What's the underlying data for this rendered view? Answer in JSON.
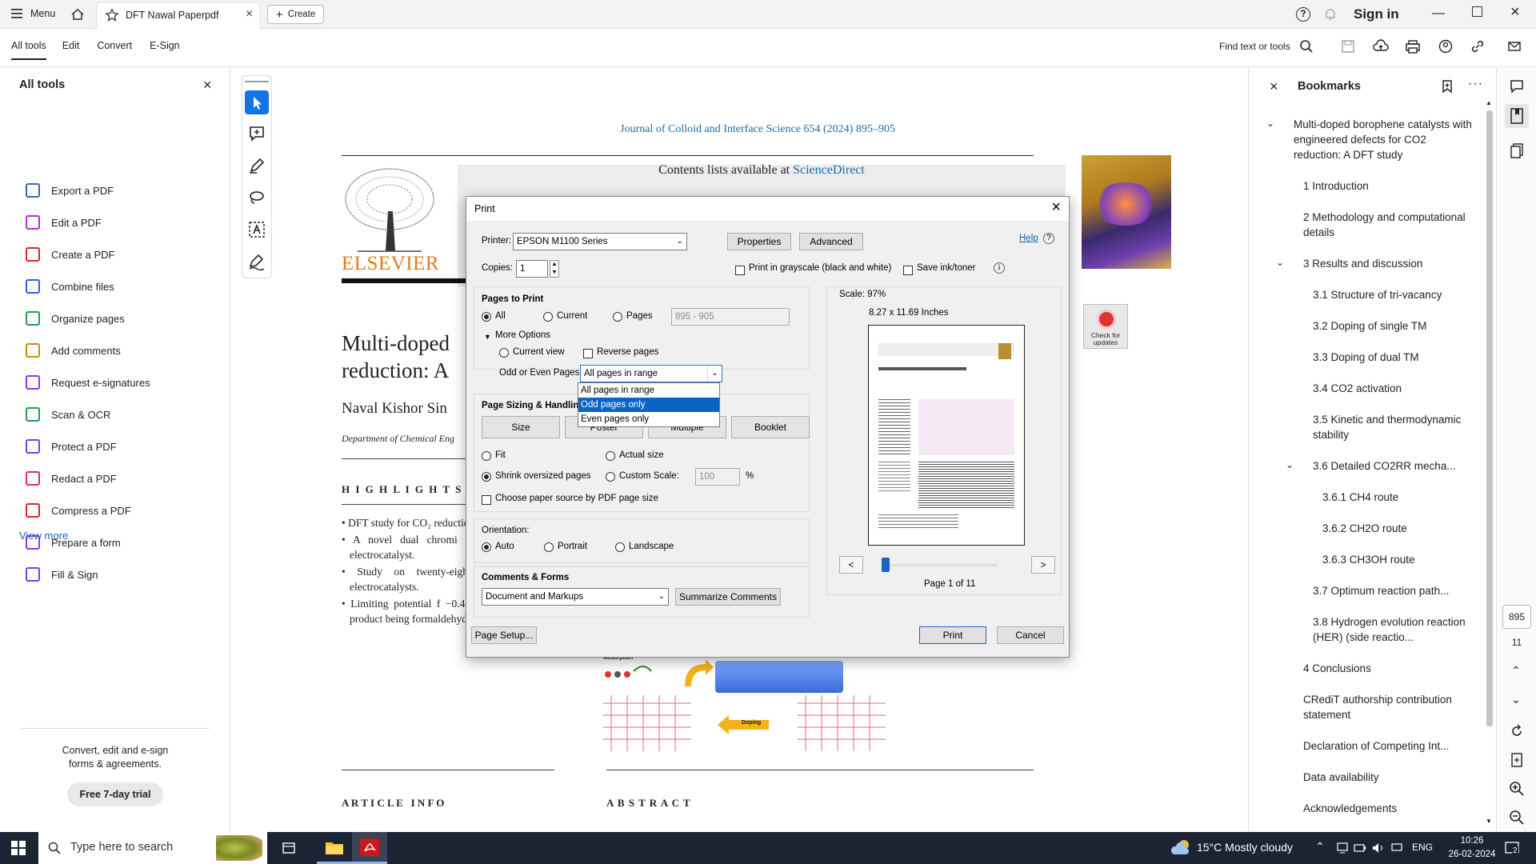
{
  "titlebar": {
    "menu_label": "Menu",
    "tab_title": "DFT Nawal Paperpdf",
    "create_label": "Create",
    "sign_in": "Sign in"
  },
  "toolbar": {
    "menus": [
      "All tools",
      "Edit",
      "Convert",
      "E-Sign"
    ],
    "find_label": "Find text or tools"
  },
  "left_panel": {
    "title": "All tools",
    "items": [
      {
        "label": "Export a PDF",
        "color": "#2b6cb0"
      },
      {
        "label": "Edit a PDF",
        "color": "#c026d3"
      },
      {
        "label": "Create a PDF",
        "color": "#dc2626"
      },
      {
        "label": "Combine files",
        "color": "#2563eb"
      },
      {
        "label": "Organize pages",
        "color": "#16a34a"
      },
      {
        "label": "Add comments",
        "color": "#ca8a04"
      },
      {
        "label": "Request e-signatures",
        "color": "#9333ea"
      },
      {
        "label": "Scan & OCR",
        "color": "#16a34a"
      },
      {
        "label": "Protect a PDF",
        "color": "#7c3aed"
      },
      {
        "label": "Redact a PDF",
        "color": "#db2777"
      },
      {
        "label": "Compress a PDF",
        "color": "#dc2626"
      },
      {
        "label": "Prepare a form",
        "color": "#9333ea"
      },
      {
        "label": "Fill & Sign",
        "color": "#7c3aed"
      }
    ],
    "view_more": "View more",
    "promo_line1": "Convert, edit and e-sign",
    "promo_line2": "forms & agreements.",
    "trial_button": "Free 7-day trial"
  },
  "document": {
    "journal": "Journal of Colloid and Interface Science 654 (2024) 895–905",
    "contents_prefix": "Contents lists available at",
    "contents_link": "ScienceDirect",
    "publisher": "ELSEVIER",
    "title_line1": "Multi-doped",
    "title_line2": "reduction: A",
    "authors": "Naval Kishor Sin",
    "affiliation": "Department of Chemical Eng",
    "check_updates": "Check for updates",
    "highlights_heading": "H I G H L I G H T S",
    "highlights": [
      "DFT study for CO₂ reduction to value-add",
      "A novel dual chromi vacancy borophene electrocatalyst.",
      "Study on twenty-eigh atom tri-vacant electrocatalysts.",
      "Limiting potential f −0.45 V, with the main product being formaldehyde."
    ],
    "figure_labels": [
      "Adsorption",
      "Doping"
    ],
    "article_info": "A R T I C L E   I N F O",
    "abstract": "A B S T R A C T"
  },
  "print_dialog": {
    "title": "Print",
    "printer_label": "Printer:",
    "printer_value": "EPSON M1100 Series",
    "properties": "Properties",
    "advanced": "Advanced",
    "help": "Help",
    "copies_label": "Copies:",
    "copies_value": "1",
    "grayscale": "Print in grayscale (black and white)",
    "save_ink": "Save ink/toner",
    "pages_to_print": "Pages to Print",
    "all": "All",
    "current": "Current",
    "pages": "Pages",
    "pages_range": "895 - 905",
    "more_options": "More Options",
    "current_view": "Current view",
    "reverse_pages": "Reverse pages",
    "odd_even_label": "Odd or Even Pages:",
    "odd_even_value": "All pages in range",
    "dropdown_options": [
      "All pages in range",
      "Odd pages only",
      "Even pages only"
    ],
    "page_sizing": "Page Sizing & Handling",
    "sizing_buttons": [
      "Size",
      "Poster",
      "Multiple",
      "Booklet"
    ],
    "fit": "Fit",
    "actual_size": "Actual size",
    "shrink": "Shrink oversized pages",
    "custom_scale": "Custom Scale:",
    "custom_scale_value": "100",
    "percent": "%",
    "paper_source": "Choose paper source by PDF page size",
    "orientation": "Orientation:",
    "auto": "Auto",
    "portrait": "Portrait",
    "landscape": "Landscape",
    "comments_forms": "Comments & Forms",
    "comments_value": "Document and Markups",
    "summarize": "Summarize Comments",
    "scale": "Scale:  97%",
    "paper_size": "8.27 x 11.69 Inches",
    "page_of": "Page 1 of 11",
    "prev": "<",
    "next": ">",
    "page_setup": "Page Setup...",
    "print_btn": "Print",
    "cancel_btn": "Cancel"
  },
  "bookmarks": {
    "title": "Bookmarks",
    "items": [
      {
        "label": "Multi-doped borophene catalysts with engineered defects for CO2 reduction: A DFT study",
        "level": 0,
        "expanded": true
      },
      {
        "label": "1 Introduction",
        "level": 1
      },
      {
        "label": "2 Methodology and computational details",
        "level": 1
      },
      {
        "label": "3 Results and discussion",
        "level": 1,
        "expanded": true
      },
      {
        "label": "3.1 Structure of tri-vacancy",
        "level": 2
      },
      {
        "label": "3.2 Doping of single TM",
        "level": 2
      },
      {
        "label": "3.3 Doping of dual TM",
        "level": 2
      },
      {
        "label": "3.4 CO2 activation",
        "level": 2
      },
      {
        "label": "3.5 Kinetic and thermodynamic stability",
        "level": 2
      },
      {
        "label": "3.6 Detailed CO2RR mecha...",
        "level": 2,
        "expanded": true
      },
      {
        "label": "3.6.1 CH4 route",
        "level": 3
      },
      {
        "label": "3.6.2 CH2O route",
        "level": 3
      },
      {
        "label": "3.6.3 CH3OH route",
        "level": 3
      },
      {
        "label": "3.7 Optimum reaction path...",
        "level": 2
      },
      {
        "label": "3.8 Hydrogen evolution reaction (HER) (side reactio...",
        "level": 2
      },
      {
        "label": "4 Conclusions",
        "level": 1
      },
      {
        "label": "CRediT authorship contribution statement",
        "level": 1
      },
      {
        "label": "Declaration of Competing Int...",
        "level": 1
      },
      {
        "label": "Data availability",
        "level": 1
      },
      {
        "label": "Acknowledgements",
        "level": 1
      }
    ]
  },
  "right_rail": {
    "page_number": "895",
    "page_count": "11"
  },
  "taskbar": {
    "search_placeholder": "Type here to search",
    "weather": "15°C  Mostly cloudy",
    "lang": "ENG",
    "time": "10:26",
    "date": "26-02-2024",
    "notifications": "2"
  }
}
